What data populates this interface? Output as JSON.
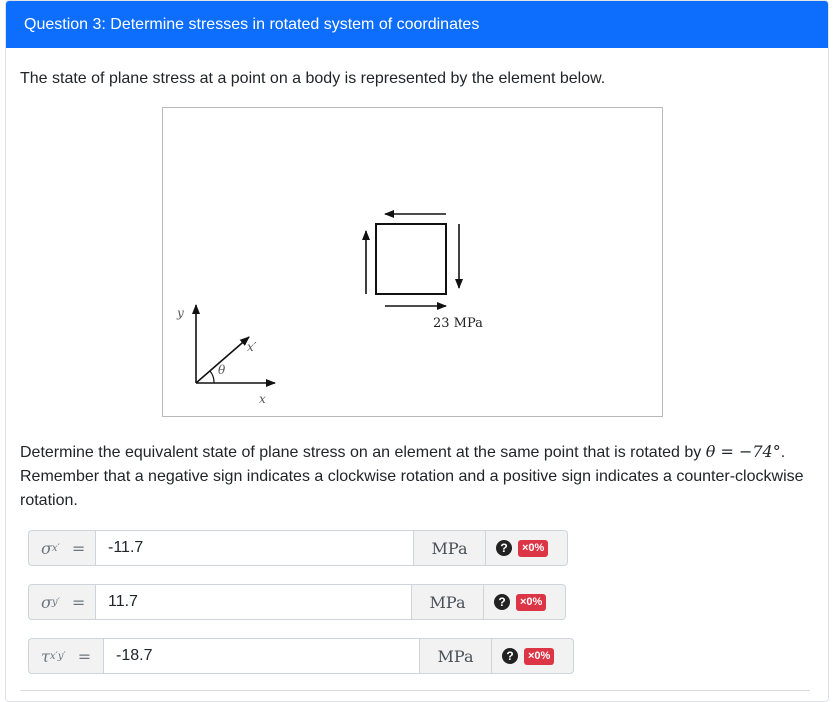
{
  "header": {
    "title": "Question 3: Determine stresses in rotated system of coordinates"
  },
  "intro": "The state of plane stress at a point on a body is represented by the element below.",
  "figure": {
    "stress_label": "23 MPa",
    "axis_y": "y",
    "axis_x": "x",
    "axis_x_prime": "x′",
    "angle_symbol": "θ"
  },
  "prompt": {
    "line_start": "Determine the equivalent state of plane stress on an element at the same point that is rotated by ",
    "theta": "θ",
    "equals": " = ",
    "angle_value": "−74°",
    "line_end": ". Remember that a negative sign indicates a clockwise rotation and a positive sign indicates a counter-clockwise rotation."
  },
  "answers": [
    {
      "symbol": "σ",
      "subscript": "x′",
      "equals": "=",
      "value": "-11.7",
      "unit": "MPa",
      "help": "?",
      "score": "×0%"
    },
    {
      "symbol": "σ",
      "subscript": "y′",
      "equals": "=",
      "value": "11.7",
      "unit": "MPa",
      "help": "?",
      "score": "×0%"
    },
    {
      "symbol": "τ",
      "subscript": "x′y′",
      "equals": "=",
      "value": "-18.7",
      "unit": "MPa",
      "help": "?",
      "score": "×0%"
    }
  ],
  "colors": {
    "header_bg": "#0d6efd",
    "badge_bg": "#dc3545"
  }
}
